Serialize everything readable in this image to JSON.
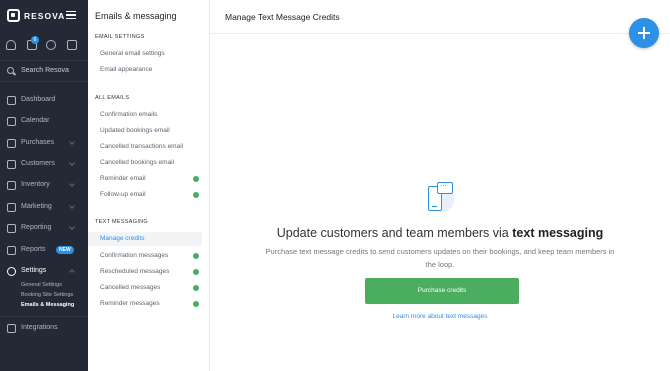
{
  "app": {
    "brand": "RESOVA"
  },
  "quick_actions": {
    "notifications_count": "6"
  },
  "search": {
    "label": "Search Resova"
  },
  "nav": {
    "dashboard": "Dashboard",
    "calendar": "Calendar",
    "purchases": "Purchases",
    "customers": "Customers",
    "inventory": "Inventory",
    "marketing": "Marketing",
    "reporting": "Reporting",
    "reports": "Reports",
    "reports_badge": "NEW",
    "settings": "Settings",
    "settings_sub": [
      "General Settings",
      "Booking Site Settings",
      "Emails & Messaging"
    ],
    "integrations": "Integrations"
  },
  "submenu": {
    "title": "Emails & messaging",
    "email_settings_heading": "EMAIL SETTINGS",
    "email_settings": [
      "General email settings",
      "Email appearance"
    ],
    "all_emails_heading": "ALL EMAILS",
    "all_emails": [
      "Confirmation emails",
      "Updated bookings email",
      "Cancelled transactions email",
      "Cancelled bookings email",
      "Reminder email",
      "Follow-up email"
    ],
    "text_messaging_heading": "TEXT MESSAGING",
    "text_messaging": [
      "Manage credits",
      "Confirmation messages",
      "Rescheduled messages",
      "Cancelled messages",
      "Reminder messages"
    ],
    "status_color": "#43b05c"
  },
  "main": {
    "title": "Manage Text Message Credits",
    "headline_prefix": "Update customers and team members via ",
    "headline_bold": "text messaging",
    "description": "Purchase text message credits to send customers updates on their bookings, and keep team members in the loop.",
    "cta": "Purchase credits",
    "learn_more": "Learn more about text messages",
    "accent": "#2e8fe6",
    "cta_color": "#4bad5f"
  }
}
